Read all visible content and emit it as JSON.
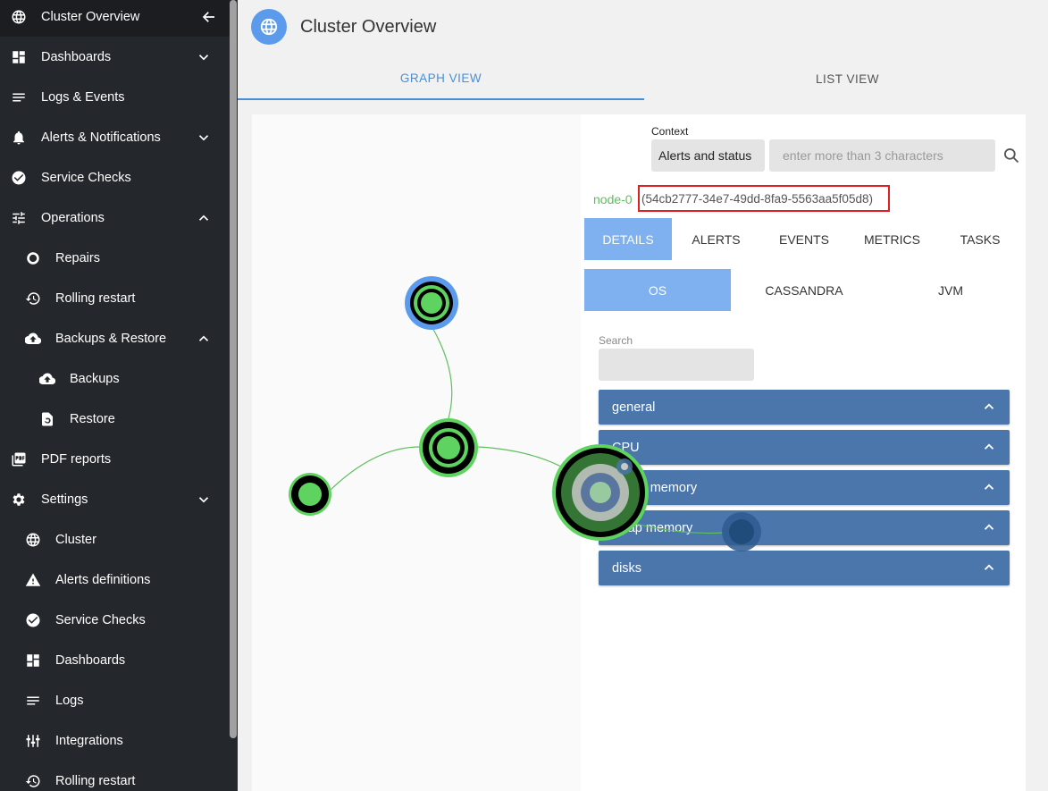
{
  "sidebar": {
    "items": [
      {
        "label": "Cluster Overview",
        "icon": "globe-icon"
      },
      {
        "label": "Dashboards",
        "icon": "dashboard-icon",
        "chevron": "down"
      },
      {
        "label": "Logs & Events",
        "icon": "lines-icon"
      },
      {
        "label": "Alerts & Notifications",
        "icon": "bell-icon",
        "chevron": "down"
      },
      {
        "label": "Service Checks",
        "icon": "check-circle-icon"
      },
      {
        "label": "Operations",
        "icon": "sliders-icon",
        "chevron": "up"
      },
      {
        "label": "Repairs",
        "icon": "ring-icon"
      },
      {
        "label": "Rolling restart",
        "icon": "history-icon"
      },
      {
        "label": "Backups & Restore",
        "icon": "cloud-upload-icon",
        "chevron": "up"
      },
      {
        "label": "Backups",
        "icon": "cloud-upload-icon"
      },
      {
        "label": "Restore",
        "icon": "restore-file-icon"
      },
      {
        "label": "PDF reports",
        "icon": "pdf-icon"
      },
      {
        "label": "Settings",
        "icon": "gear-icon",
        "chevron": "down"
      },
      {
        "label": "Cluster",
        "icon": "globe-icon"
      },
      {
        "label": "Alerts definitions",
        "icon": "warning-icon"
      },
      {
        "label": "Service Checks",
        "icon": "check-circle-icon"
      },
      {
        "label": "Dashboards",
        "icon": "dashboard-icon"
      },
      {
        "label": "Logs",
        "icon": "lines-icon"
      },
      {
        "label": "Integrations",
        "icon": "integrations-icon"
      },
      {
        "label": "Rolling restart",
        "icon": "history-icon"
      }
    ]
  },
  "header": {
    "title": "Cluster Overview"
  },
  "tabs": [
    {
      "label": "GRAPH VIEW"
    },
    {
      "label": "LIST VIEW"
    }
  ],
  "context": {
    "label": "Context",
    "selected": "Alerts and status",
    "placeholder": "enter more than 3 characters"
  },
  "node": {
    "name": "node-0",
    "id": "(54cb2777-34e7-49dd-8fa9-5563aa5f05d8)"
  },
  "detail_tabs": [
    {
      "label": "DETAILS"
    },
    {
      "label": "ALERTS"
    },
    {
      "label": "EVENTS"
    },
    {
      "label": "METRICS"
    },
    {
      "label": "TASKS"
    }
  ],
  "sub_tabs": [
    {
      "label": "OS"
    },
    {
      "label": "CASSANDRA"
    },
    {
      "label": "JVM"
    }
  ],
  "search": {
    "label": "Search"
  },
  "sections": [
    {
      "label": "general"
    },
    {
      "label": "CPU"
    },
    {
      "label": "virtual memory"
    },
    {
      "label": "swap memory"
    },
    {
      "label": "disks"
    }
  ],
  "colors": {
    "sidebar": "#24272c",
    "accent": "#4a8fd6",
    "tab_active": "#7fb0f0",
    "accordion": "#4a76ab",
    "node_green": "#5fd35f",
    "node_blue": "#5c9bec"
  }
}
